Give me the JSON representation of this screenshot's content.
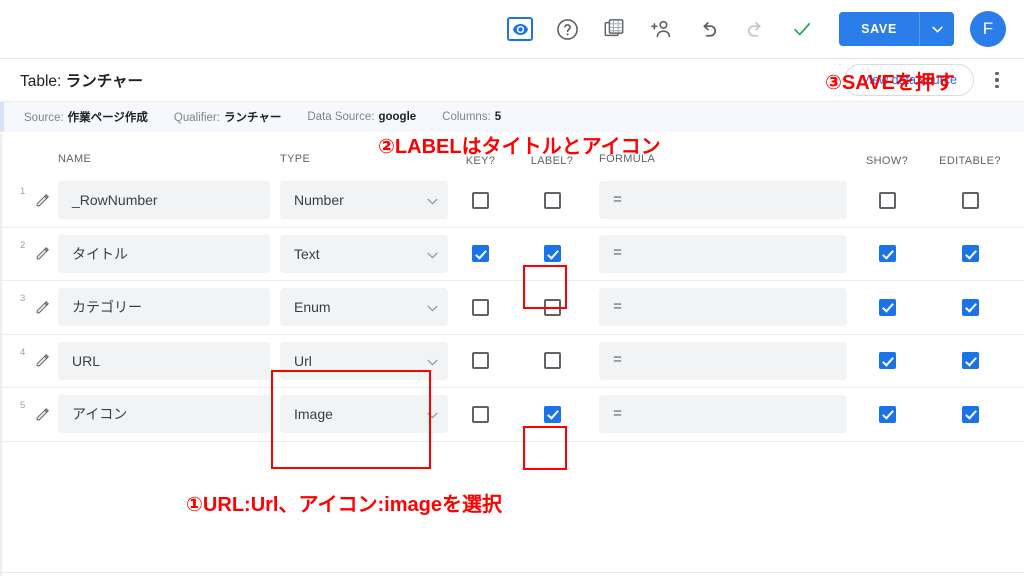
{
  "toolbar": {
    "icons": [
      {
        "name": "preview-eye-icon",
        "label": "Preview"
      },
      {
        "name": "help-circle-icon",
        "label": "Help"
      },
      {
        "name": "copy-table-icon",
        "label": "Copy"
      },
      {
        "name": "add-person-icon",
        "label": "Add user"
      },
      {
        "name": "undo-icon",
        "label": "Undo"
      },
      {
        "name": "redo-icon",
        "label": "Redo"
      },
      {
        "name": "check-icon",
        "label": "Saved"
      }
    ],
    "save_label": "SAVE",
    "avatar_initial": "F",
    "accent_color": "#2b7de9",
    "check_color": "#34a853"
  },
  "titlebar": {
    "prefix": "Table:",
    "name": "ランチャー",
    "view_data_source_label": "View data source",
    "menu_label": "More options"
  },
  "sourcebar": {
    "items": [
      {
        "label": "Source:",
        "value": "作業ページ作成"
      },
      {
        "label": "Qualifier:",
        "value": "ランチャー"
      },
      {
        "label": "Data Source:",
        "value": "google"
      },
      {
        "label": "Columns:",
        "value": "5"
      }
    ]
  },
  "grid": {
    "headers": {
      "name": "NAME",
      "type": "TYPE",
      "key": "KEY?",
      "label": "LABEL?",
      "formula": "FORMULA",
      "show": "SHOW?",
      "editable": "EDITABLE?"
    },
    "formula_symbol": "=",
    "rows": [
      {
        "num": "1",
        "name": "_RowNumber",
        "type": "Number",
        "key": false,
        "label": false,
        "formula": "",
        "show": false,
        "editable": false
      },
      {
        "num": "2",
        "name": "タイトル",
        "type": "Text",
        "key": true,
        "label": true,
        "formula": "",
        "show": true,
        "editable": true
      },
      {
        "num": "3",
        "name": "カテゴリー",
        "type": "Enum",
        "key": false,
        "label": false,
        "formula": "",
        "show": true,
        "editable": true
      },
      {
        "num": "4",
        "name": "URL",
        "type": "Url",
        "key": false,
        "label": false,
        "formula": "",
        "show": true,
        "editable": true
      },
      {
        "num": "5",
        "name": "アイコン",
        "type": "Image",
        "key": false,
        "label": true,
        "formula": "",
        "show": true,
        "editable": true
      }
    ]
  },
  "annotations": {
    "color": "#ff0000",
    "step1": "①URL:Url、アイコン:imageを選択",
    "step2": "②LABELはタイトルとアイコン",
    "step3": "③SAVEを押す"
  }
}
